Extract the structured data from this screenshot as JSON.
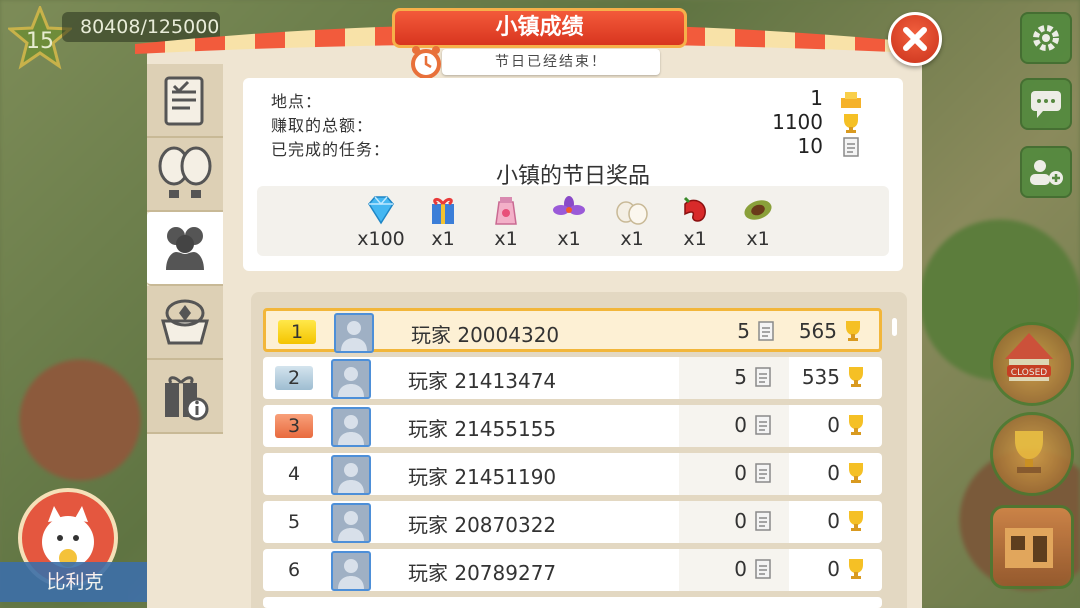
{
  "hud": {
    "level": "15",
    "xp": "80408/125000",
    "player_name": "比利克"
  },
  "popup": {
    "title": "小镇成绩",
    "subtitle": "节日已经结束！"
  },
  "summary": {
    "rows": [
      {
        "label": "地点：",
        "value": "1",
        "icon": "podium-icon"
      },
      {
        "label": "赚取的总额：",
        "value": "1100",
        "icon": "trophy-icon"
      },
      {
        "label": "已完成的任务：",
        "value": "10",
        "icon": "task-card-icon"
      }
    ],
    "prize_title": "小镇的节日奖品",
    "prizes": [
      {
        "icon": "diamond-icon",
        "count": "x100"
      },
      {
        "icon": "gift-box-icon",
        "count": "x1"
      },
      {
        "icon": "seed-bag-icon",
        "count": "x1"
      },
      {
        "icon": "saffron-flower-icon",
        "count": "x1"
      },
      {
        "icon": "eggs-icon",
        "count": "x1"
      },
      {
        "icon": "chili-pepper-icon",
        "count": "x1"
      },
      {
        "icon": "cocoa-pod-icon",
        "count": "x1"
      }
    ]
  },
  "leaderboard": [
    {
      "rank": "1",
      "name": "玩家 20004320",
      "tasks": "5",
      "score": "565"
    },
    {
      "rank": "2",
      "name": "玩家 21413474",
      "tasks": "5",
      "score": "535"
    },
    {
      "rank": "3",
      "name": "玩家 21455155",
      "tasks": "0",
      "score": "0"
    },
    {
      "rank": "4",
      "name": "玩家 21451190",
      "tasks": "0",
      "score": "0"
    },
    {
      "rank": "5",
      "name": "玩家 20870322",
      "tasks": "0",
      "score": "0"
    },
    {
      "rank": "6",
      "name": "玩家 20789277",
      "tasks": "0",
      "score": "0"
    }
  ],
  "side_buttons": {
    "closed_sign": "CLOSED"
  },
  "colors": {
    "title_red": "#d8351f",
    "highlight_gold": "#f2b63a",
    "avatar_border": "#4d8fd8"
  }
}
